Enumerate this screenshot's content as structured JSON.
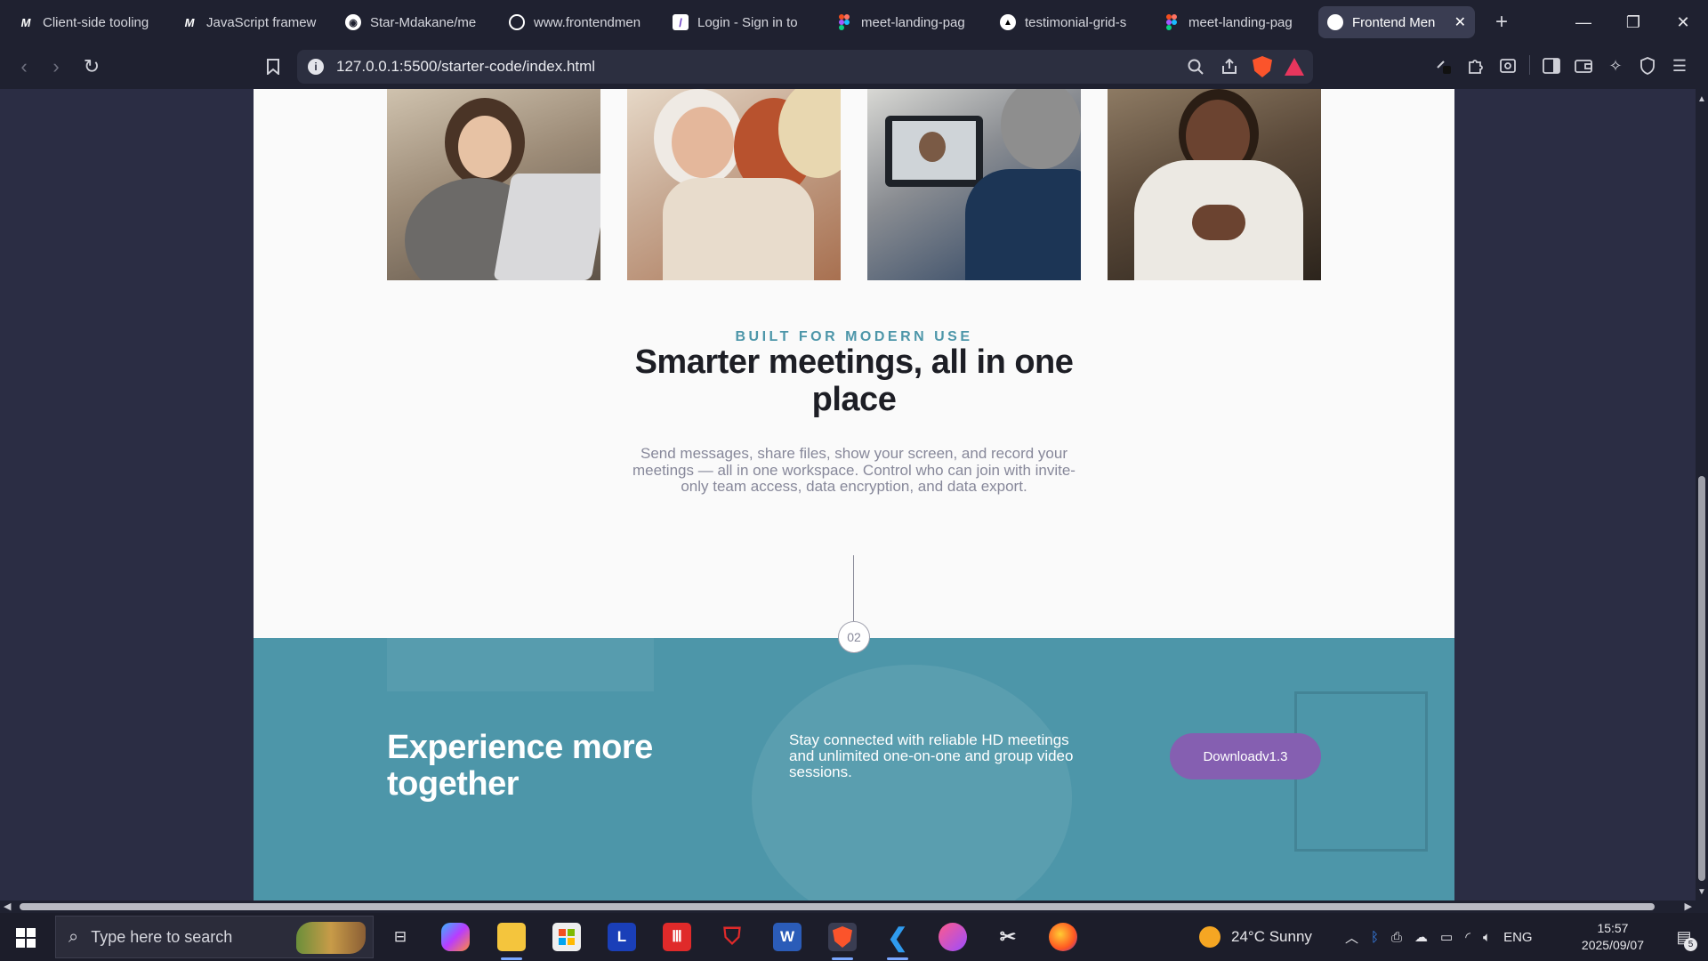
{
  "browser": {
    "tabs": [
      {
        "title": "Client-side tooling",
        "icon": "mdn-icon"
      },
      {
        "title": "JavaScript framew",
        "icon": "mdn-icon"
      },
      {
        "title": "Star-Mdakane/me",
        "icon": "github-icon"
      },
      {
        "title": "www.frontendmen",
        "icon": "frontendmentor-icon"
      },
      {
        "title": "Login - Sign in to",
        "icon": "login-icon"
      },
      {
        "title": "meet-landing-pag",
        "icon": "figma-icon"
      },
      {
        "title": "testimonial-grid-s",
        "icon": "vercel-icon"
      },
      {
        "title": "meet-landing-pag",
        "icon": "figma-icon"
      },
      {
        "title": "Frontend Men",
        "icon": "frontendmentor-icon",
        "active": true
      }
    ],
    "url": "127.0.0.1:5500/starter-code/index.html",
    "accent": "#3a3d52"
  },
  "page": {
    "eyebrow": "BUILT FOR MODERN USE",
    "headline": "Smarter meetings, all in one place",
    "body": "Send messages, share files, show your screen, and record your meetings — all in one workspace. Control who can join with invite-only team access, data encryption, and data export.",
    "step_number": "02",
    "cta": {
      "title": "Experience more together",
      "text": "Stay connected with reliable HD meetings and unlimited one-on-one and group video sessions.",
      "button_label": "Download",
      "button_version": "v1.3",
      "background": "#4d96a9",
      "button_color": "#855fb1"
    },
    "photos": [
      "woman-laptop-photo",
      "women-phone-photo",
      "video-call-photo",
      "man-phone-photo"
    ]
  },
  "taskbar": {
    "search_placeholder": "Type here to search",
    "weather": "24°C  Sunny",
    "language": "ENG",
    "time": "15:57",
    "date": "2025/09/07",
    "notification_count": "5"
  }
}
